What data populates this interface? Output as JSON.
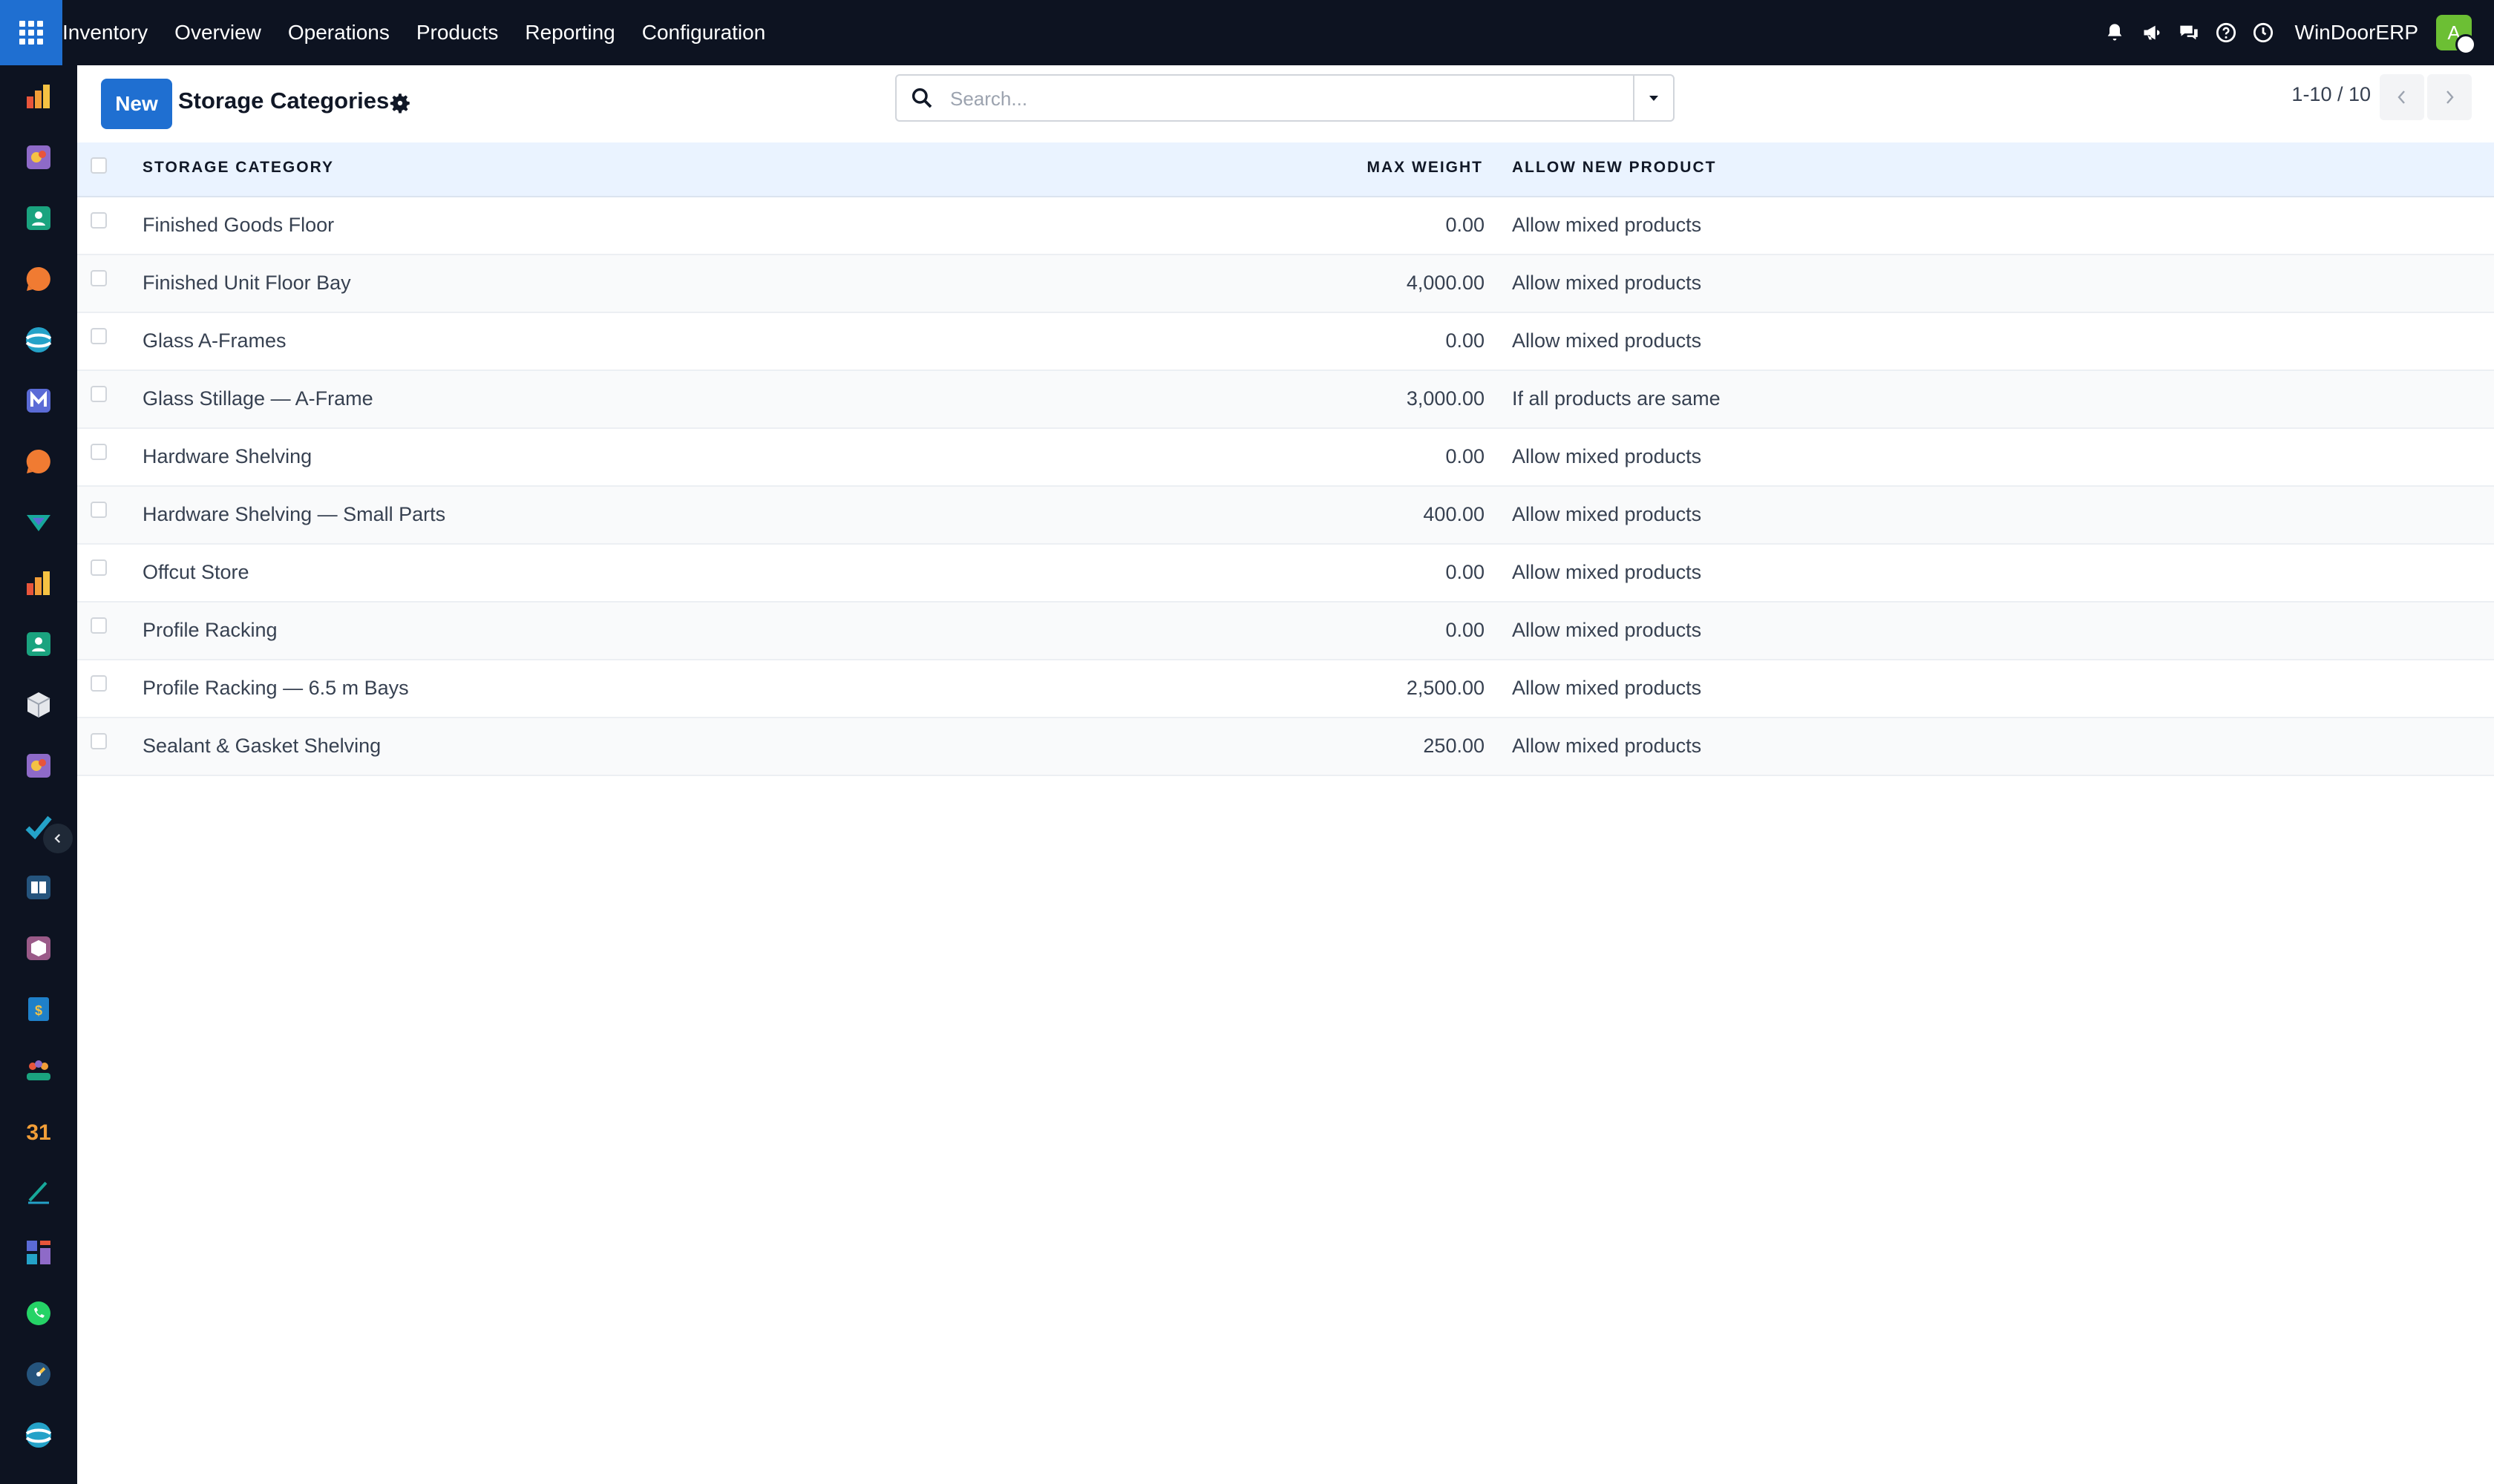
{
  "topbar": {
    "menu": [
      "Inventory",
      "Overview",
      "Operations",
      "Products",
      "Reporting",
      "Configuration"
    ],
    "company": "WinDoorERP",
    "avatar_initial": "A",
    "icons": [
      "bell-icon",
      "megaphone-icon",
      "chat-icon",
      "help-icon",
      "clock-icon"
    ],
    "accent": "#1f6fd1",
    "background": "#0d1321"
  },
  "control": {
    "new_label": "New",
    "title": "Storage Categories",
    "search_placeholder": "Search...",
    "pager": "1-10 / 10"
  },
  "table": {
    "headers": {
      "category": "STORAGE CATEGORY",
      "max_weight": "MAX WEIGHT",
      "allow_new": "ALLOW NEW PRODUCT"
    },
    "rows": [
      {
        "category": "Finished Goods Floor",
        "max_weight": "0.00",
        "allow_new": "Allow mixed products"
      },
      {
        "category": "Finished Unit Floor Bay",
        "max_weight": "4,000.00",
        "allow_new": "Allow mixed products"
      },
      {
        "category": "Glass A-Frames",
        "max_weight": "0.00",
        "allow_new": "Allow mixed products"
      },
      {
        "category": "Glass Stillage — A-Frame",
        "max_weight": "3,000.00",
        "allow_new": "If all products are same"
      },
      {
        "category": "Hardware Shelving",
        "max_weight": "0.00",
        "allow_new": "Allow mixed products"
      },
      {
        "category": "Hardware Shelving — Small Parts",
        "max_weight": "400.00",
        "allow_new": "Allow mixed products"
      },
      {
        "category": "Offcut Store",
        "max_weight": "0.00",
        "allow_new": "Allow mixed products"
      },
      {
        "category": "Profile Racking",
        "max_weight": "0.00",
        "allow_new": "Allow mixed products"
      },
      {
        "category": "Profile Racking — 6.5 m Bays",
        "max_weight": "2,500.00",
        "allow_new": "Allow mixed products"
      },
      {
        "category": "Sealant & Gasket Shelving",
        "max_weight": "250.00",
        "allow_new": "Allow mixed products"
      }
    ]
  },
  "rail": {
    "apps": [
      "dashboard-app-icon",
      "purchase-app-icon",
      "contacts-app-icon",
      "discuss-app-icon",
      "website-app-icon",
      "email-marketing-app-icon",
      "live-chat-app-icon",
      "field-service-app-icon",
      "dashboard-app-icon-2",
      "contacts-app-icon-2",
      "inventory-app-icon",
      "purchase-app-icon-2",
      "project-app-icon",
      "knowledge-app-icon",
      "barcode-app-icon",
      "expenses-app-icon",
      "employees-app-icon",
      "calendar-app-icon",
      "sign-app-icon",
      "apps-app-icon",
      "whatsapp-app-icon",
      "timesheet-app-icon",
      "website-app-icon-2"
    ],
    "calendar_day": "31"
  }
}
